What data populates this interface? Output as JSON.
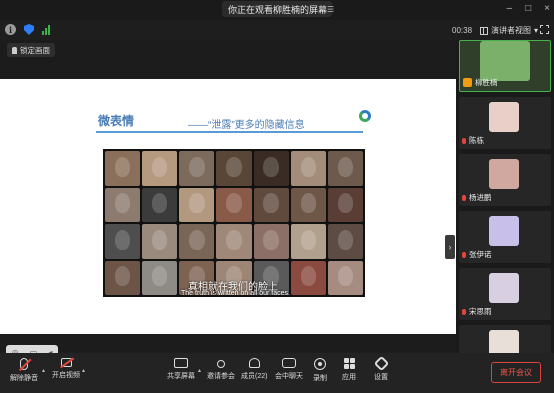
{
  "window": {
    "title": "你正在观看柳胜楠的屏幕"
  },
  "infobar": {
    "timer": "00:38",
    "view_label": "演讲者视图"
  },
  "stage": {
    "lock_label": "锁定画面"
  },
  "slide": {
    "title": "微表情",
    "subtitle": "——“泄露”更多的隐藏信息",
    "caption_cn": "真相就在我们的脸上",
    "caption_en": "The truth is written on all our faces.",
    "faces": [
      "#8a6f5a",
      "#b59a80",
      "#7c6a5c",
      "#5a4636",
      "#3a2c24",
      "#a38d7a",
      "#6d5a4c",
      "#8c7b6e",
      "#3b3b3b",
      "#b39880",
      "#8a5a48",
      "#604a3e",
      "#6f5748",
      "#5a3e36",
      "#4e4e4e",
      "#9a8a7e",
      "#7a6656",
      "#a08878",
      "#8c6f66",
      "#b2a08e",
      "#5c4c44",
      "#6c5446",
      "#8e8a86",
      "#7e6252",
      "#9e8676",
      "#5a5a5a",
      "#8a4a40",
      "#a68c80"
    ]
  },
  "participants": [
    {
      "name": "柳胜楠",
      "avatar_color": "#7ab06a",
      "mic": "host"
    },
    {
      "name": "陈栋",
      "avatar_color": "#e8d0c8",
      "mic": "muted"
    },
    {
      "name": "杨进鹏",
      "avatar_color": "#d0a8a0",
      "mic": "muted"
    },
    {
      "name": "张伊诺",
      "avatar_color": "#c8c0e8",
      "mic": "muted"
    },
    {
      "name": "宋思雨",
      "avatar_color": "#d8d0e0",
      "mic": "muted"
    },
    {
      "name": "",
      "avatar_color": "#e8e0d8",
      "mic": "muted"
    }
  ],
  "toolbar": {
    "mute": "解除静音",
    "video": "开启视频",
    "share": "共享屏幕",
    "invite": "邀请参会",
    "members": "成员(22)",
    "chat": "会中聊天",
    "record": "录制",
    "apps": "应用",
    "settings": "设置",
    "leave": "离开会议"
  }
}
